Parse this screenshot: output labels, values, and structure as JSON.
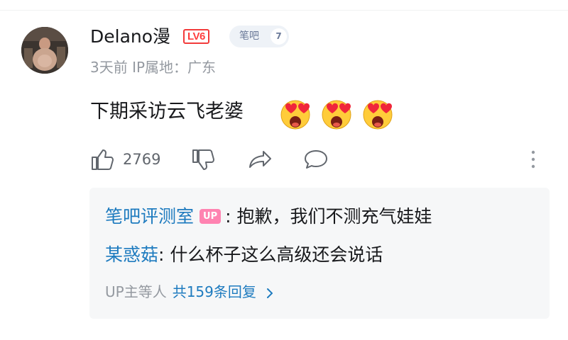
{
  "comment": {
    "username": "Delano漫",
    "level_badge": "LV6",
    "fan_badge": {
      "name": "笔吧",
      "level": "7"
    },
    "meta": "3天前 IP属地：广东",
    "content": "下期采访云飞老婆",
    "emoji_icon": "heart-eyes-emoji",
    "emoji_count": 3
  },
  "actions": {
    "like_count": "2769",
    "icons": [
      "thumbs-up-icon",
      "thumbs-down-icon",
      "share-icon",
      "reply-icon",
      "more-icon"
    ]
  },
  "replies": [
    {
      "user": "笔吧评测室",
      "up_tag": "UP",
      "separator": ":",
      "text": "抱歉，我们不测充气娃娃"
    },
    {
      "user": "某惑菇",
      "separator": ":",
      "text": "什么杯子这么高级还会说话"
    }
  ],
  "reply_summary": {
    "prefix": "UP主等人",
    "count_text": "共159条回复"
  },
  "colors": {
    "accent": "#1e7bbf",
    "level_red": "#f23b3b",
    "up_pink": "#ff83b1",
    "muted": "#9499a0"
  }
}
